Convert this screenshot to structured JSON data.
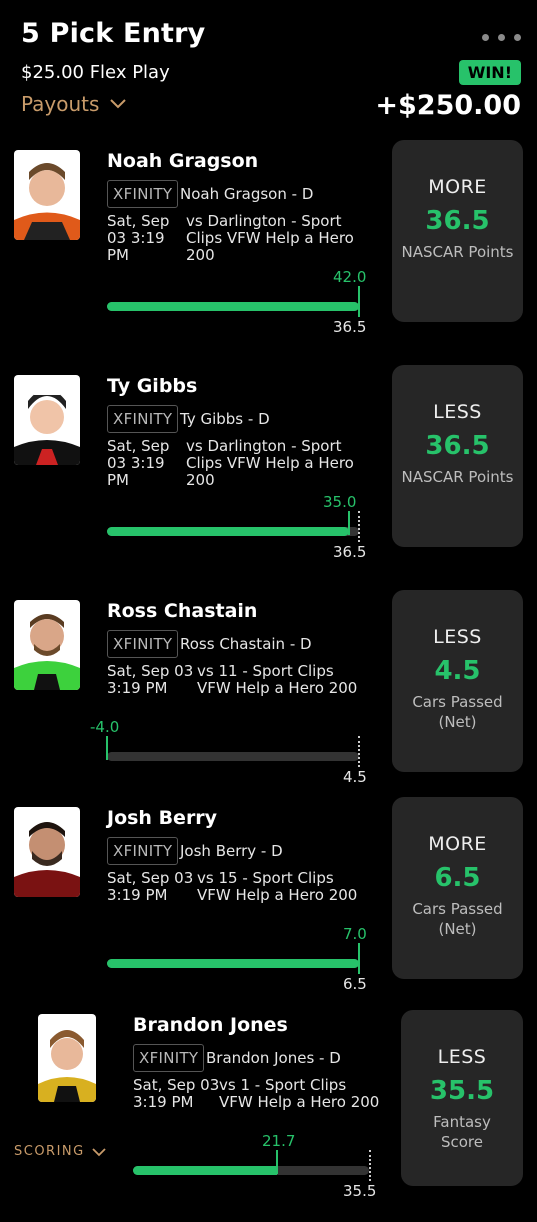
{
  "header": {
    "title": "5 Pick Entry",
    "subtitle": "$25.00 Flex Play",
    "payouts_label": "Payouts",
    "result_badge": "WIN!",
    "winnings": "+$250.00"
  },
  "scoring_label": "SCORING",
  "colors": {
    "accent_green": "#27c26a",
    "accent_orange": "#c89b6a",
    "card_bg": "#262626"
  },
  "picks": [
    {
      "name": "Noah Gragson",
      "series": "XFINITY",
      "prop_name": "Noah Gragson - D",
      "game_time": "Sat, Sep 03 3:19 PM",
      "opponent": "vs Darlington - Sport Clips VFW Help a Hero 200",
      "actual": "42.0",
      "line": "36.5",
      "direction": "MORE",
      "line_value": "36.5",
      "stat": "NASCAR Points",
      "progress": 1.0
    },
    {
      "name": "Ty Gibbs",
      "series": "XFINITY",
      "prop_name": "Ty Gibbs - D",
      "game_time": "Sat, Sep 03 3:19 PM",
      "opponent": "vs Darlington - Sport Clips VFW Help a Hero 200",
      "actual": "35.0",
      "line": "36.5",
      "direction": "LESS",
      "line_value": "36.5",
      "stat": "NASCAR Points",
      "progress": 0.96
    },
    {
      "name": "Ross Chastain",
      "series": "XFINITY",
      "prop_name": "Ross Chastain - D",
      "game_time": "Sat, Sep 03 3:19 PM",
      "opponent": "vs 11 - Sport Clips VFW Help a Hero 200",
      "actual": "-4.0",
      "line": "4.5",
      "direction": "LESS",
      "line_value": "4.5",
      "stat": "Cars Passed (Net)",
      "progress": 0.0
    },
    {
      "name": "Josh Berry",
      "series": "XFINITY",
      "prop_name": "Josh Berry - D",
      "game_time": "Sat, Sep 03 3:19 PM",
      "opponent": "vs 15 - Sport Clips VFW Help a Hero 200",
      "actual": "7.0",
      "line": "6.5",
      "direction": "MORE",
      "line_value": "6.5",
      "stat": "Cars Passed (Net)",
      "progress": 1.0
    },
    {
      "name": "Brandon Jones",
      "series": "XFINITY",
      "prop_name": "Brandon Jones - D",
      "game_time": "Sat, Sep 03 3:19 PM",
      "opponent": "vs 1 - Sport Clips VFW Help a Hero 200",
      "actual": "21.7",
      "line": "35.5",
      "direction": "LESS",
      "line_value": "35.5",
      "stat": "Fantasy Score",
      "progress": 0.61
    }
  ]
}
